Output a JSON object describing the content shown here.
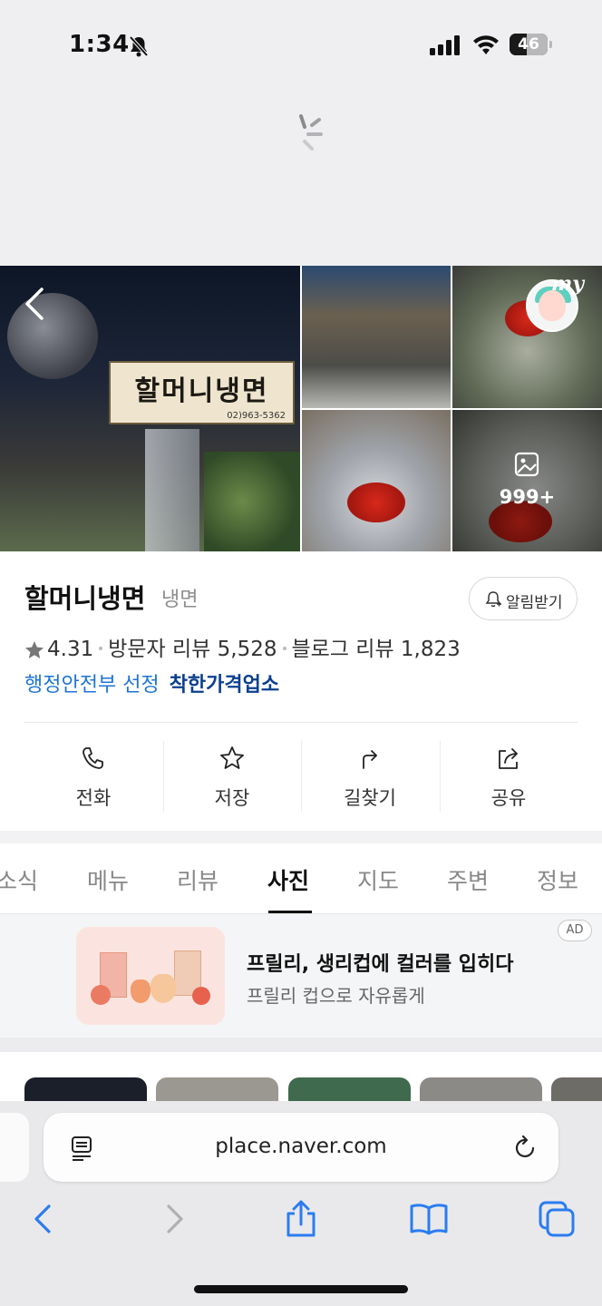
{
  "status_bar": {
    "time": "1:34",
    "battery": "46",
    "battery_level": 0.46
  },
  "place": {
    "name": "할머니냉면",
    "category": "냉면",
    "alarm_label": "알림받기",
    "rating": "4.31",
    "visitor_reviews": "방문자 리뷰 5,528",
    "blog_reviews": "블로그 리뷰 1,823",
    "gov_text": "행정안전부 선정",
    "gov_badge": "착한가격업소"
  },
  "photos": {
    "more_count": "999+",
    "my_label": "my"
  },
  "actions": [
    {
      "label": "전화",
      "icon": "phone-icon"
    },
    {
      "label": "저장",
      "icon": "star-icon"
    },
    {
      "label": "길찾기",
      "icon": "directions-icon"
    },
    {
      "label": "공유",
      "icon": "share-icon"
    }
  ],
  "tabs": [
    {
      "label": "소식"
    },
    {
      "label": "메뉴"
    },
    {
      "label": "리뷰"
    },
    {
      "label": "사진",
      "active": true
    },
    {
      "label": "지도"
    },
    {
      "label": "주변"
    },
    {
      "label": "정보"
    }
  ],
  "ad": {
    "title": "프릴리, 생리컵에 컬러를 입히다",
    "subtitle": "프릴리 컵으로 자유롭게",
    "badge": "AD"
  },
  "browser": {
    "url": "place.naver.com"
  },
  "colors": {
    "link_blue": "#1e74d6",
    "badge_navy": "#0b3f8f",
    "ios_blue": "#2b7cf1"
  }
}
